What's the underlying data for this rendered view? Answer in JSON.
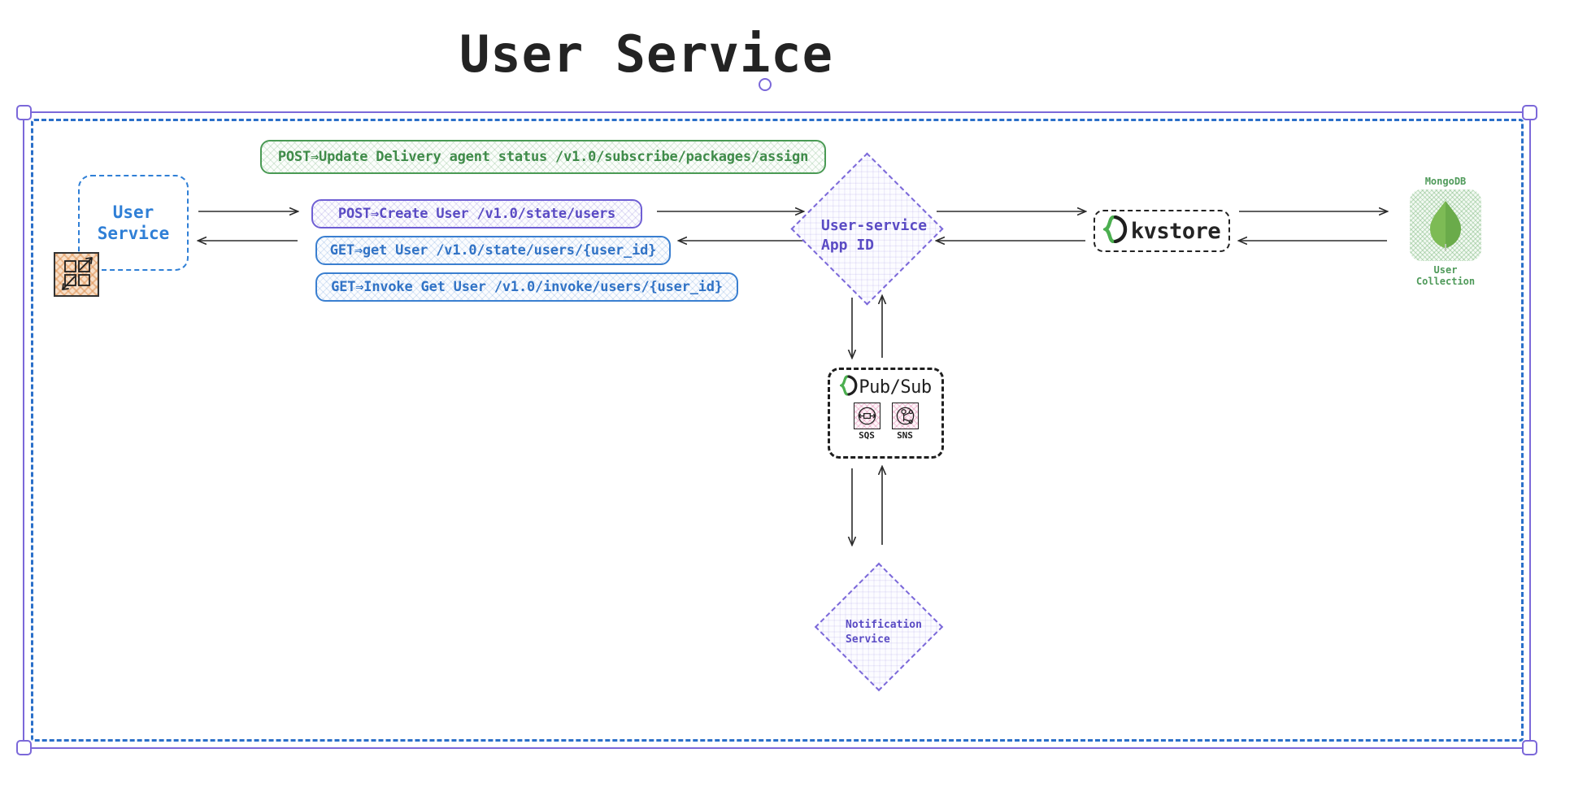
{
  "title": "User Service",
  "selection": {
    "handles": [
      "top-left",
      "top-right",
      "bottom-left",
      "bottom-right"
    ],
    "rotate_handle": "rotate",
    "accent_color": "#7b68d9"
  },
  "container": {
    "name": "User Service",
    "border_color": "#2a6fc9",
    "border_style": "dashed"
  },
  "nodes": {
    "user_service": {
      "label": "User\nService",
      "color": "#2f7fd6",
      "shape": "rounded-rect-dashed"
    },
    "microservice_icon": {
      "name": "microservices-icon",
      "fill": "#f7dfc8"
    },
    "app_id": {
      "label": "User-service\nApp ID",
      "color": "#5a4bc4",
      "shape": "diamond-dashed"
    },
    "kvstore": {
      "label": "kvstore",
      "logo": "dapr-logo",
      "logo_color": "#4caf50",
      "color": "#242424",
      "shape": "rounded-rect-dashed"
    },
    "mongodb": {
      "title": "MongoDB",
      "caption": "User\nCollection",
      "color": "#4f9a5a",
      "logo": "mongodb-leaf-icon"
    },
    "pubsub": {
      "label": "Pub/Sub",
      "logo": "dapr-logo",
      "logo_color": "#4caf50",
      "color": "#1f1f1f",
      "queues": [
        {
          "label": "SQS",
          "icon": "sqs-icon"
        },
        {
          "label": "SNS",
          "icon": "sns-icon"
        }
      ]
    },
    "notification_service": {
      "label": "Notification\nService",
      "color": "#5a4bc4",
      "shape": "diamond-dashed"
    }
  },
  "api_boxes": [
    {
      "id": "subscribe",
      "text": "POST⇒Update Delivery agent status /v1.0/subscribe/packages/assign",
      "color": "#3f8b49",
      "style": "green"
    },
    {
      "id": "create_user",
      "text": "POST⇒Create User /v1.0/state/users",
      "color": "#5a4bc4",
      "style": "purple"
    },
    {
      "id": "get_user",
      "text": "GET⇒get User /v1.0/state/users/{user_id}",
      "color": "#3173c6",
      "style": "blue"
    },
    {
      "id": "invoke_get_user",
      "text": "GET⇒Invoke Get User /v1.0/invoke/users/{user_id}",
      "color": "#3173c6",
      "style": "blue"
    }
  ]
}
